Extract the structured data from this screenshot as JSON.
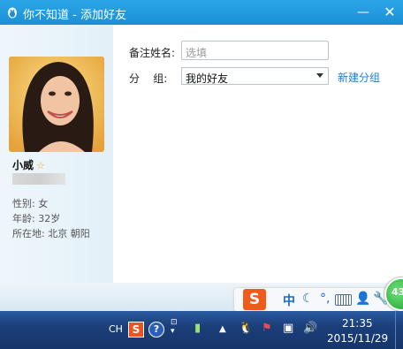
{
  "window": {
    "title": "你不知道 - 添加好友",
    "minimize": "—",
    "close": "✕",
    "icons": {
      "logo": "qq-penguin-icon"
    }
  },
  "profile": {
    "nickname": "小威",
    "vip_badge": "☆",
    "gender": "性别: 女",
    "age": "年龄: 32岁",
    "location": "所在地: 北京  朝阳"
  },
  "form": {
    "remark_label": "备注姓名:",
    "remark_placeholder": "选填",
    "group_label": "分    组:",
    "group_value": "我的好友",
    "new_group_link": "新建分组"
  },
  "ime": {
    "logo": "S",
    "mode": "中",
    "moon": "☾",
    "punct": "°,",
    "user": "👤",
    "wrench": "🔧"
  },
  "speed_ball": {
    "value": "43"
  },
  "taskbar": {
    "lang": "CH",
    "sogou": "S",
    "help": "?",
    "time": "21:35",
    "date": "2015/11/29"
  },
  "colors": {
    "titlebar": "#1b8fd6",
    "link": "#1e7ccf",
    "taskbar": "#1b3f7a"
  }
}
